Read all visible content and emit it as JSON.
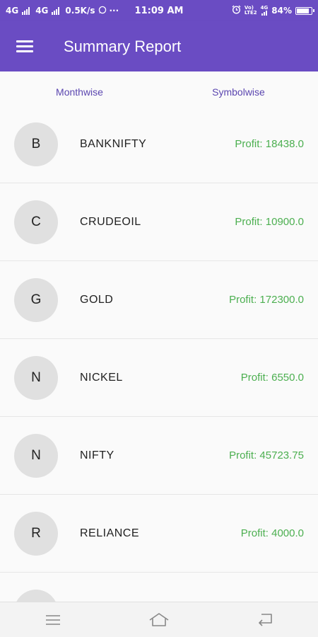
{
  "status_bar": {
    "net1": "4G",
    "net2": "4G",
    "speed": "0.5K/s",
    "dots": "···",
    "time": "11:09 AM",
    "volte_top": "Vo)",
    "volte_bottom": "LTE2",
    "net3": "4G",
    "battery": "84%",
    "battery_level": 0.84
  },
  "app_bar": {
    "title": "Summary Report"
  },
  "tabs": [
    {
      "label": "Monthwise",
      "active": false
    },
    {
      "label": "Symbolwise",
      "active": true
    }
  ],
  "items": [
    {
      "initial": "B",
      "symbol": "BANKNIFTY",
      "profit": "Profit: 18438.0"
    },
    {
      "initial": "C",
      "symbol": "CRUDEOIL",
      "profit": "Profit: 10900.0"
    },
    {
      "initial": "G",
      "symbol": "GOLD",
      "profit": "Profit: 172300.0"
    },
    {
      "initial": "N",
      "symbol": "NICKEL",
      "profit": "Profit: 6550.0"
    },
    {
      "initial": "N",
      "symbol": "NIFTY",
      "profit": "Profit: 45723.75"
    },
    {
      "initial": "R",
      "symbol": "RELIANCE",
      "profit": "Profit: 4000.0"
    },
    {
      "initial": "",
      "symbol": "",
      "profit": ""
    }
  ],
  "colors": {
    "primary": "#6a4cc3",
    "tab_text": "#5b46b0",
    "profit": "#4caf50",
    "avatar_bg": "#e0e0e0"
  },
  "icons": {
    "menu": "hamburger-menu-icon",
    "whatsapp": "whatsapp-icon",
    "alarm": "alarm-icon",
    "battery": "battery-icon",
    "nav_menu": "nav-menu-icon",
    "nav_home": "nav-home-icon",
    "nav_back": "nav-back-icon"
  }
}
